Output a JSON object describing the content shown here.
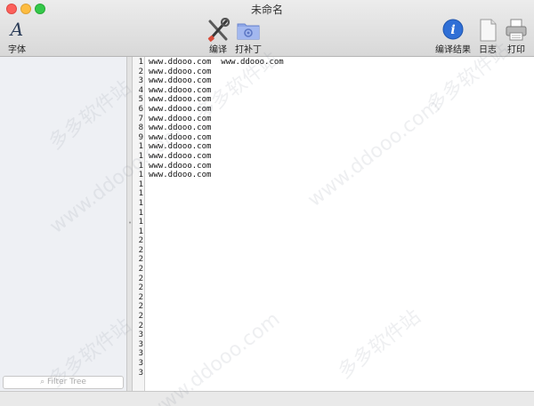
{
  "window": {
    "title": "未命名"
  },
  "toolbar": {
    "font_label": "字体",
    "compile_label": "编译",
    "patch_label": "打补丁",
    "compile_result_label": "编译结果",
    "log_label": "日志",
    "print_label": "打印",
    "info_icon_glyph": "i"
  },
  "sidebar": {
    "filter_placeholder": "Filter Tree"
  },
  "editor": {
    "line_numbers": [
      "1",
      "2",
      "3",
      "4",
      "5",
      "6",
      "7",
      "8",
      "9",
      "1",
      "1",
      "1",
      "1",
      "1",
      "1",
      "1",
      "1",
      "1",
      "1",
      "2",
      "2",
      "2",
      "2",
      "2",
      "2",
      "2",
      "2",
      "2",
      "2",
      "3",
      "3",
      "3",
      "3",
      "3"
    ],
    "lines": [
      "www.ddooo.com  www.ddooo.com",
      "www.ddooo.com",
      "www.ddooo.com",
      "www.ddooo.com",
      "www.ddooo.com",
      "www.ddooo.com",
      "www.ddooo.com",
      "www.ddooo.com",
      "www.ddooo.com",
      "www.ddooo.com",
      "www.ddooo.com",
      "www.ddooo.com",
      "www.ddooo.com"
    ]
  },
  "watermark": {
    "brand_cn": "多多软件站",
    "url": "www.ddooo.com"
  },
  "colors": {
    "close": "#fc605b",
    "minimize": "#fdbc40",
    "maximize": "#34c84a",
    "info_blue": "#2f6fd6",
    "patch_folder": "#8fa7e6"
  }
}
